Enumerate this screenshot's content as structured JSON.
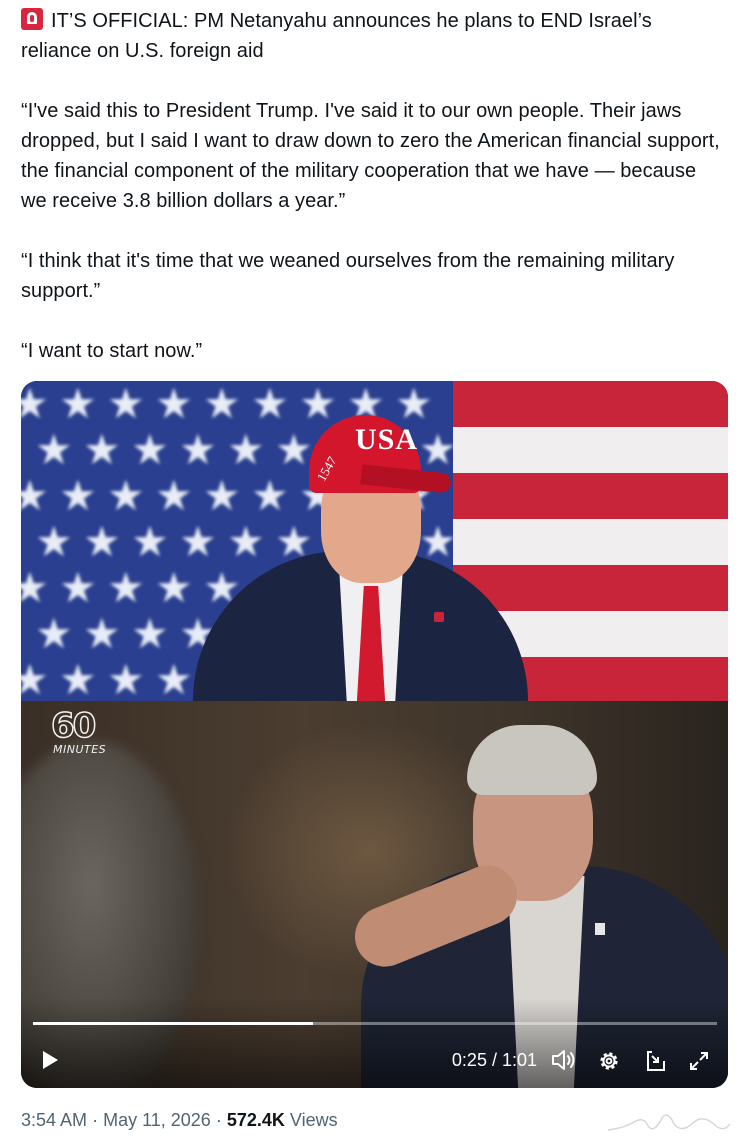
{
  "tweet": {
    "icon": "rotating-light-emoji",
    "headline": "IT’S OFFICIAL: PM Netanyahu announces he plans to END Israel’s reliance on U.S. foreign aid",
    "quote1": "“I've said this to President Trump. I've said it to our own people. Their jaws dropped, but I said I want to draw down to zero the American financial support, the financial component of the military cooperation that we have — because we receive 3.8 billion dollars a year.”",
    "quote2": "“I think that it's time that we weaned ourselves from the remaining military support.”",
    "quote3": "“I want to start now.”"
  },
  "video": {
    "cap_text": "USA",
    "cap_side_text": "1547",
    "logo_number": "60",
    "logo_word": "MINUTES",
    "progress_fraction": 0.41,
    "time": "0:25 / 1:01",
    "icons": {
      "play": "play-icon",
      "volume": "volume-icon",
      "settings": "gear-icon",
      "pip": "picture-in-picture-icon",
      "fullscreen": "fullscreen-icon"
    }
  },
  "meta": {
    "time": "3:54 AM",
    "sep1": "·",
    "date": "May 11, 2026",
    "sep2": "·",
    "views_count": "572.4K",
    "views_label": "Views"
  },
  "colors": {
    "text": "#0f1419",
    "secondary": "#536471",
    "flag_blue": "#2a3f8f",
    "flag_red": "#c8253a",
    "cap_red": "#d3162c"
  }
}
